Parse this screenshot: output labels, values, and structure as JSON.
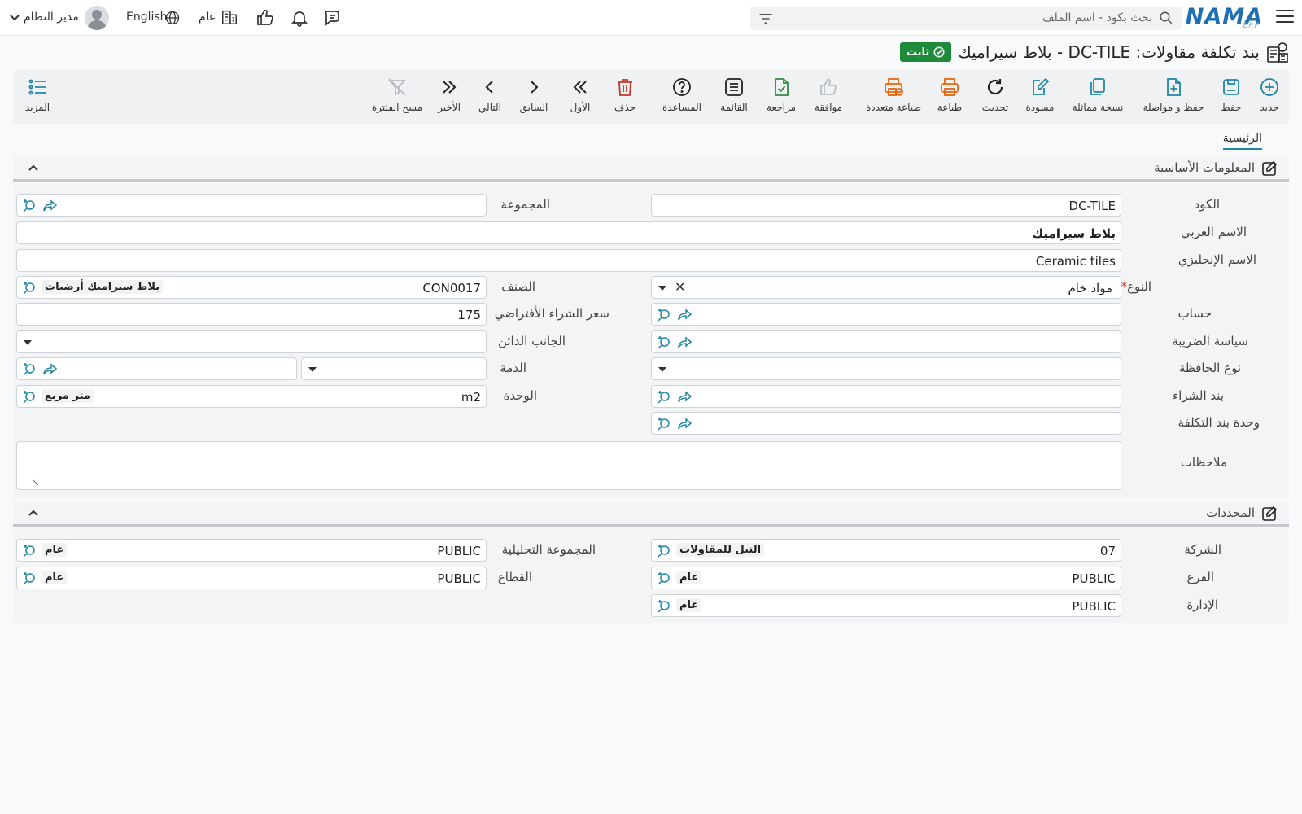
{
  "header": {
    "logo": "NAMA",
    "logo_sub": "ERP",
    "search_placeholder": "بحث بكود - اسم الملف",
    "company_label": "عام",
    "language": "English",
    "user": "مدير النظام"
  },
  "page": {
    "title": "بند تكلفة مقاولات: DC-TILE - بلاط سيراميك",
    "status": "ثابت"
  },
  "toolbar": {
    "new": "جديد",
    "save": "حفظ",
    "save_continue": "حفظ و مواصلة",
    "duplicate": "نسخة مماثلة",
    "draft": "مسودة",
    "refresh": "تحديث",
    "print": "طباعة",
    "multi_print": "طباعة متعددة",
    "approve": "موافقة",
    "review": "مراجعة",
    "list": "القائمة",
    "help": "المساعدة",
    "delete": "حذف",
    "first": "الأول",
    "previous": "السابق",
    "next": "التالي",
    "last": "الأخير",
    "clear_filter": "مسح الفلترة",
    "more": "المزيد"
  },
  "tabs": {
    "main": "الرئيسية"
  },
  "basic_info": {
    "title": "المعلومات الأساسية",
    "labels": {
      "code": "الكود",
      "arabic_name": "الاسم العربي",
      "english_name": "الاسم الإنجليزي",
      "type": "النوع",
      "account": "حساب",
      "tax_policy": "سياسة الضريبة",
      "wallet_type": "نوع الحافظة",
      "purchase_item": "بند الشراء",
      "cost_item_unit": "وحدة بند التكلفة",
      "notes": "ملاحظات",
      "group": "المجموعة",
      "category": "الصنف",
      "default_purchase_price": "سعر الشراء الأفتراضي",
      "credit_side": "الجانب الدائن",
      "liability": "الذمة",
      "unit": "الوحدة"
    },
    "values": {
      "code": "DC-TILE",
      "arabic_name": "بلاط سيراميك",
      "english_name": "Ceramic tiles",
      "type": "مواد خام",
      "category_code": "CON0017",
      "category_name": "بلاط سيراميك أرضيات",
      "default_purchase_price": "175",
      "unit_code": "m2",
      "unit_name": "متر مربع"
    }
  },
  "dimensions": {
    "title": "المحددات",
    "labels": {
      "company": "الشركة",
      "branch": "الفرع",
      "department": "الإدارة",
      "analysis_group": "المجموعة التحليلية",
      "sector": "القطاع"
    },
    "values": {
      "company_code": "07",
      "company_name": "النيل للمقاولات",
      "branch_code": "PUBLIC",
      "branch_name": "عام",
      "department_code": "PUBLIC",
      "department_name": "عام",
      "analysis_group_code": "PUBLIC",
      "analysis_group_name": "عام",
      "sector_code": "PUBLIC",
      "sector_name": "عام"
    }
  },
  "colors": {
    "accent": "#1f86a7",
    "status_green": "#1e8b3a",
    "print_orange": "#e8630a",
    "delete_red": "#c0392b",
    "review_green": "#2e8b3e"
  }
}
